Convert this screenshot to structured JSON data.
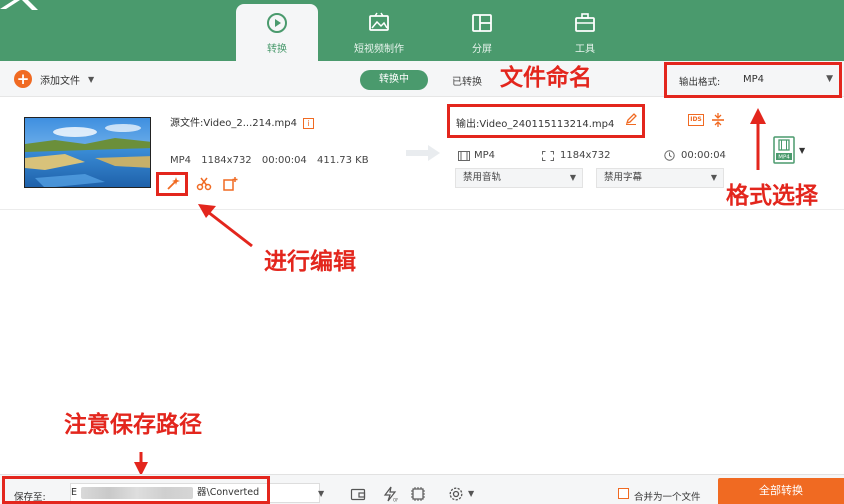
{
  "nav": {
    "tabs": [
      {
        "label": "转换",
        "icon": "convert-icon",
        "active": true
      },
      {
        "label": "短视频制作",
        "icon": "short-video-icon",
        "active": false
      },
      {
        "label": "分屏",
        "icon": "split-screen-icon",
        "active": false
      },
      {
        "label": "工具",
        "icon": "toolbox-icon",
        "active": false
      }
    ]
  },
  "toolbar": {
    "add_file_label": "添加文件",
    "status_converting": "转换中",
    "status_converted": "已转换",
    "output_format_label": "输出格式:",
    "output_format_value": "MP4"
  },
  "item": {
    "source_label": "源文件:",
    "source_name": "Video_2...214.mp4",
    "meta": {
      "format": "MP4",
      "resolution": "1184x732",
      "duration": "00:00:04",
      "size": "411.73 KB"
    },
    "output_label": "输出:",
    "output_name": "Video_240115113214.mp4",
    "output_format": "MP4",
    "output_resolution": "1184x732",
    "output_duration": "00:00:04",
    "audio_track": "禁用音轨",
    "subtitle": "禁用字幕",
    "format_badge": "MP4"
  },
  "annotations": {
    "file_naming": "文件命名",
    "format_select": "格式选择",
    "edit": "进行编辑",
    "save_path_note": "注意保存路径"
  },
  "bottom": {
    "save_to_label": "保存至:",
    "save_path_prefix": "E",
    "save_path": "器\\Converted",
    "merge_label": "合并为一个文件",
    "convert_all_label": "全部转换"
  },
  "colors": {
    "brand_green": "#4a9a6d",
    "accent_orange": "#f06a22",
    "annotation_red": "#e3261d"
  }
}
